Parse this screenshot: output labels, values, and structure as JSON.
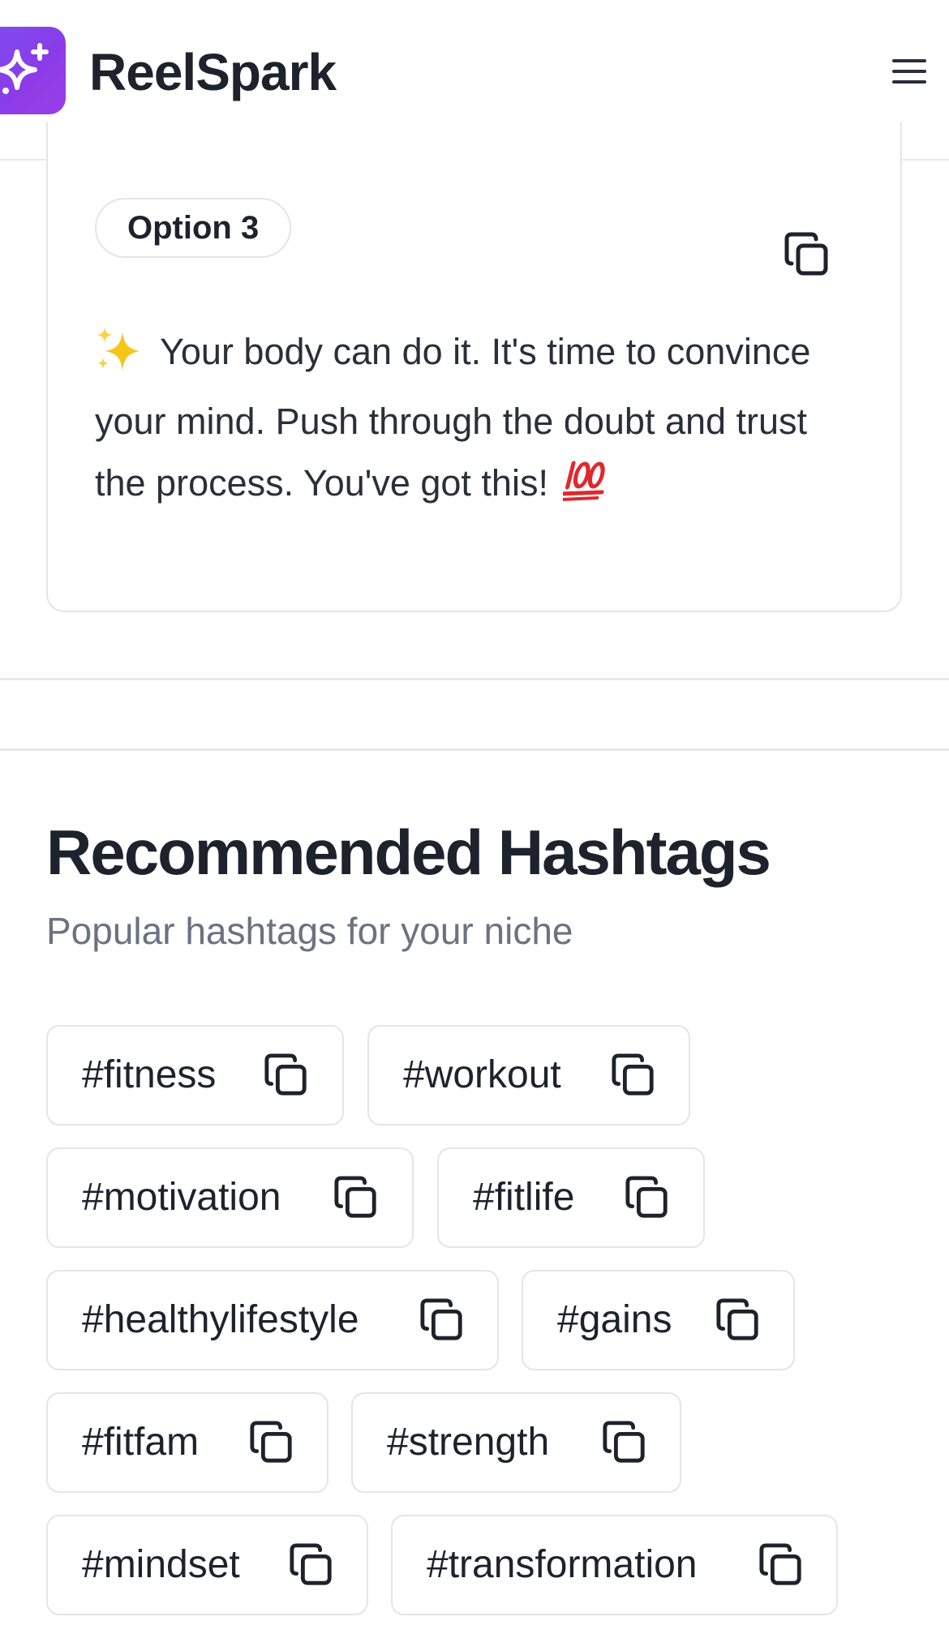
{
  "header": {
    "brand": "ReelSpark",
    "logo_icon": "sparkles-icon",
    "menu_icon": "hamburger-menu-icon"
  },
  "caption_card": {
    "option_label": "Option 3",
    "copy_icon": "copy-icon",
    "caption_text": "Your body can do it. It's time to convince your mind. Push through the doubt and trust the process. You've got this!",
    "leading_emoji": "sparkles",
    "trailing_emoji": "hundred-points"
  },
  "hashtags_section": {
    "title": "Recommended Hashtags",
    "subtitle": "Popular hashtags for your niche",
    "tags": [
      "#fitness",
      "#workout",
      "#motivation",
      "#fitlife",
      "#healthylifestyle",
      "#gains",
      "#fitfam",
      "#strength",
      "#mindset",
      "#transformation"
    ]
  },
  "colors": {
    "brand_gradient_start": "#7b4ff0",
    "brand_gradient_end": "#9b3fe6",
    "text_primary": "#1d222c",
    "text_secondary": "#6b7280",
    "border": "#e3e5e9",
    "emoji_red": "#e0282e",
    "sparkle_yellow": "#f5c518"
  }
}
